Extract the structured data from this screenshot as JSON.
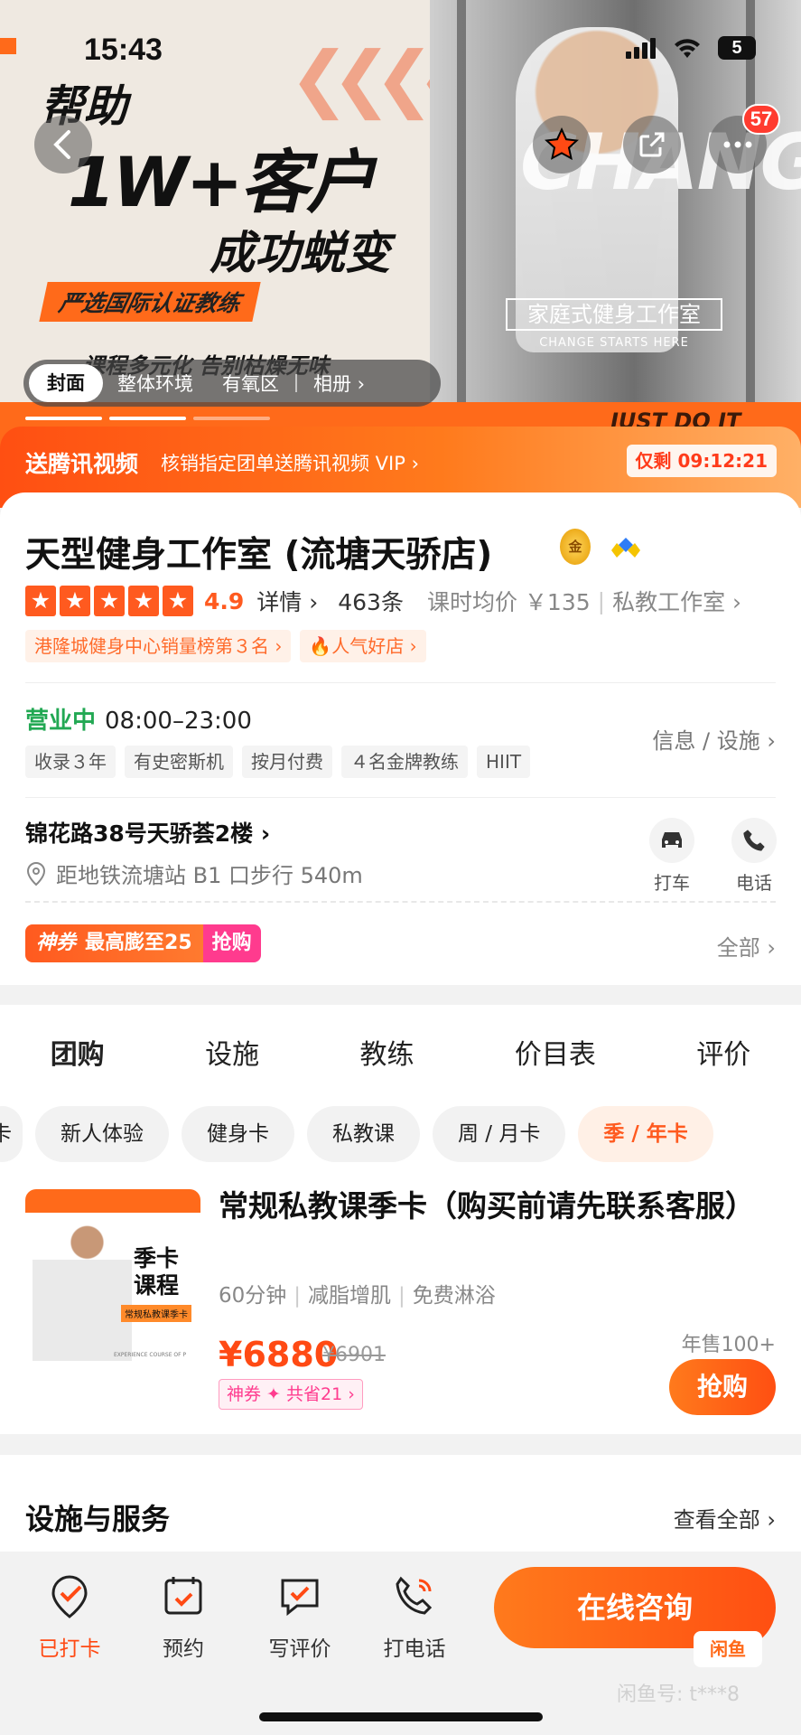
{
  "status_bar": {
    "time": "15:43",
    "battery": "5"
  },
  "hero": {
    "headline_1": "帮助",
    "headline_2": "1W+客户",
    "headline_3": "成功蜕变",
    "tagline": "严选国际认证教练",
    "slogan": "课程多元化 告别枯燥无味",
    "right_brand": "CHANGE",
    "right_banner": "家庭式健身工作室",
    "right_banner_sub": "CHANGE STARTS HERE",
    "bottom_text": "JUST DO IT",
    "notification_count": "57",
    "album_tabs": [
      "封面",
      "整体环境",
      "有氧区",
      "相册 ›"
    ]
  },
  "promo": {
    "title": "送腾讯视频",
    "desc": "核销指定团单送腾讯视频 VIP ›",
    "timer": "仅剩 09:12:21"
  },
  "store": {
    "name": "天型健身工作室 (流塘天骄店)",
    "gold_badge": "金",
    "rating": "4.9",
    "detail_link": "详情 ›",
    "review_count": "463条",
    "avg_price": "课时均价 ￥135",
    "category": "私教工作室 ›",
    "rank_tags": [
      "港隆城健身中心销量榜第３名 ›",
      "人气好店 ›"
    ],
    "open_status": "营业中",
    "hours": "08:00–23:00",
    "info_link": "信息 / 设施 ›",
    "feature_tags": [
      "收录３年",
      "有史密斯机",
      "按月付费",
      "４名金牌教练",
      "HIIT"
    ],
    "address": "锦花路38号天骄荟2楼 ›",
    "metro": "距地铁流塘站 B1 口步行 540m",
    "actions": [
      "打车",
      "电话"
    ],
    "coupon_brand": "神券",
    "coupon_text": "最高膨至25",
    "coupon_action": "抢购",
    "all_link": "全部 ›"
  },
  "tabs": [
    "团购",
    "设施",
    "教练",
    "价目表",
    "评价"
  ],
  "chips": [
    "卡",
    "新人体验",
    "健身卡",
    "私教课",
    "周 / 月卡",
    "季 / 年卡"
  ],
  "deal": {
    "img_title": "季卡\n课程",
    "img_badge": "常规私教课季卡",
    "img_foot": "EXPERIENCE COURSE OF P",
    "title": "常规私教课季卡（购买前请先联系客服）",
    "meta": [
      "60分钟",
      "减脂增肌",
      "免费淋浴"
    ],
    "price": "¥6880",
    "original_price": "¥6901",
    "save_tag": "神券 ✦ 共省21 ›",
    "sold": "年售100+",
    "buy_label": "抢购"
  },
  "services": {
    "title": "设施与服务",
    "link": "查看全部 ›"
  },
  "bottom_bar": {
    "items": [
      "已打卡",
      "预约",
      "写评价",
      "打电话"
    ],
    "consult": "在线咨询",
    "wm_logo": "闲鱼",
    "wm_text": "闲鱼号: t***8"
  },
  "colors": {
    "accent": "#ff5a1f",
    "open_green": "#22a853",
    "pink": "#ff3b8e"
  }
}
